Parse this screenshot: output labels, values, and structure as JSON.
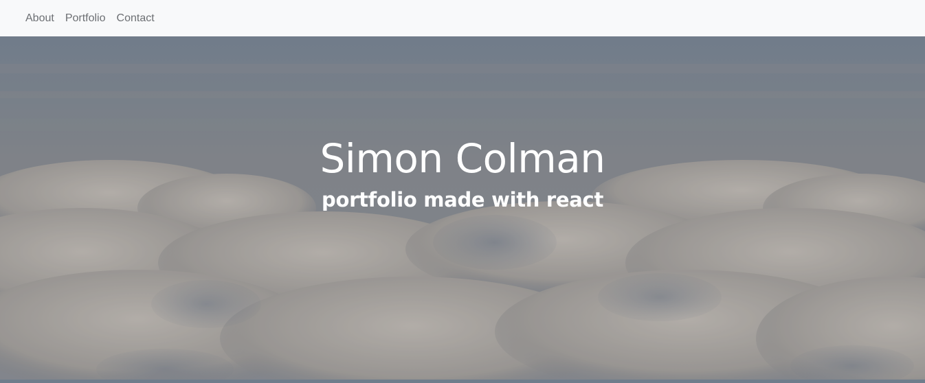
{
  "nav": {
    "items": [
      {
        "label": "About"
      },
      {
        "label": "Portfolio"
      },
      {
        "label": "Contact"
      }
    ]
  },
  "hero": {
    "title": "Simon Colman",
    "subtitle": "portfolio made with react",
    "background": "clouds-image"
  },
  "colors": {
    "navbar_bg": "#f8f9fa",
    "nav_text": "#6c6f73",
    "hero_text": "#ffffff"
  }
}
